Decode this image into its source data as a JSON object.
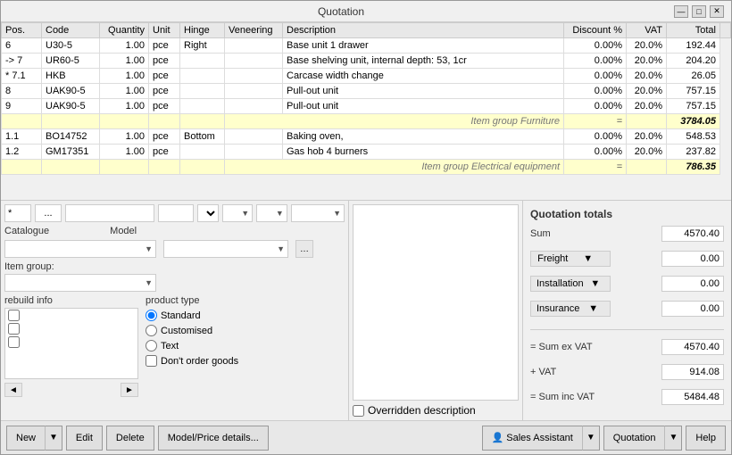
{
  "window": {
    "title": "Quotation",
    "min_btn": "—",
    "max_btn": "□",
    "close_btn": "✕"
  },
  "table": {
    "columns": [
      "Pos.",
      "Code",
      "Quantity",
      "Unit",
      "Hinge",
      "Veneering",
      "Description",
      "Discount %",
      "VAT",
      "Total"
    ],
    "rows": [
      {
        "pos": "6",
        "code": "U30-5",
        "qty": "1.00",
        "unit": "pce",
        "hinge": "Right",
        "veneer": "",
        "desc": "Base unit 1 drawer",
        "discount": "0.00%",
        "vat": "20.0%",
        "total": "192.44",
        "type": "normal"
      },
      {
        "pos": "-> 7",
        "code": "UR60-5",
        "qty": "1.00",
        "unit": "pce",
        "hinge": "",
        "veneer": "",
        "desc": "Base shelving unit, internal depth: 53, 1cr",
        "discount": "0.00%",
        "vat": "20.0%",
        "total": "204.20",
        "type": "normal"
      },
      {
        "pos": "* 7.1",
        "code": "HKB",
        "qty": "1.00",
        "unit": "pce",
        "hinge": "",
        "veneer": "",
        "desc": "Carcase width change",
        "discount": "0.00%",
        "vat": "20.0%",
        "total": "26.05",
        "type": "normal"
      },
      {
        "pos": "8",
        "code": "UAK90-5",
        "qty": "1.00",
        "unit": "pce",
        "hinge": "",
        "veneer": "",
        "desc": "Pull-out unit",
        "discount": "0.00%",
        "vat": "20.0%",
        "total": "757.15",
        "type": "normal"
      },
      {
        "pos": "9",
        "code": "UAK90-5",
        "qty": "1.00",
        "unit": "pce",
        "hinge": "",
        "veneer": "",
        "desc": "Pull-out unit",
        "discount": "0.00%",
        "vat": "20.0%",
        "total": "757.15",
        "type": "normal"
      },
      {
        "pos": "",
        "code": "",
        "qty": "",
        "unit": "",
        "hinge": "",
        "veneer": "Item group Furniture",
        "desc": "",
        "discount": "=",
        "vat": "",
        "total": "3784.05",
        "type": "group"
      },
      {
        "pos": "1.1",
        "code": "BO14752",
        "qty": "1.00",
        "unit": "pce",
        "hinge": "Bottom",
        "veneer": "",
        "desc": "Baking oven,",
        "discount": "0.00%",
        "vat": "20.0%",
        "total": "548.53",
        "type": "normal"
      },
      {
        "pos": "1.2",
        "code": "GM17351",
        "qty": "1.00",
        "unit": "pce",
        "hinge": "",
        "veneer": "",
        "desc": "Gas hob 4 burners",
        "discount": "0.00%",
        "vat": "20.0%",
        "total": "237.82",
        "type": "normal"
      },
      {
        "pos": "",
        "code": "",
        "qty": "",
        "unit": "",
        "hinge": "",
        "veneer": "Item group Electrical equipment",
        "desc": "",
        "discount": "=",
        "vat": "",
        "total": "786.35",
        "type": "group"
      }
    ]
  },
  "form": {
    "pos_placeholder": "",
    "dots_placeholder": "...",
    "catalogue_label": "Catalogue",
    "model_label": "Model",
    "itemgroup_label": "Item group:",
    "rebuild_label": "rebuild info",
    "product_type_label": "product type",
    "product_options": [
      "Standard",
      "Customised",
      "Text"
    ],
    "dont_order_label": "Don't order goods",
    "overridden_label": "Overridden description"
  },
  "totals": {
    "title": "Quotation totals",
    "sum_label": "Sum",
    "sum_value": "4570.40",
    "freight_label": "Freight",
    "freight_value": "0.00",
    "installation_label": "Installation",
    "installation_value": "0.00",
    "insurance_label": "Insurance",
    "insurance_value": "0.00",
    "sum_ex_vat_label": "= Sum ex VAT",
    "sum_ex_vat_value": "4570.40",
    "vat_label": "+ VAT",
    "vat_value": "914.08",
    "sum_inc_vat_label": "= Sum inc VAT",
    "sum_inc_vat_value": "5484.48"
  },
  "toolbar": {
    "new_label": "New",
    "edit_label": "Edit",
    "delete_label": "Delete",
    "model_price_label": "Model/Price details...",
    "sales_assistant_label": "Sales Assistant",
    "quotation_label": "Quotation",
    "help_label": "Help"
  }
}
